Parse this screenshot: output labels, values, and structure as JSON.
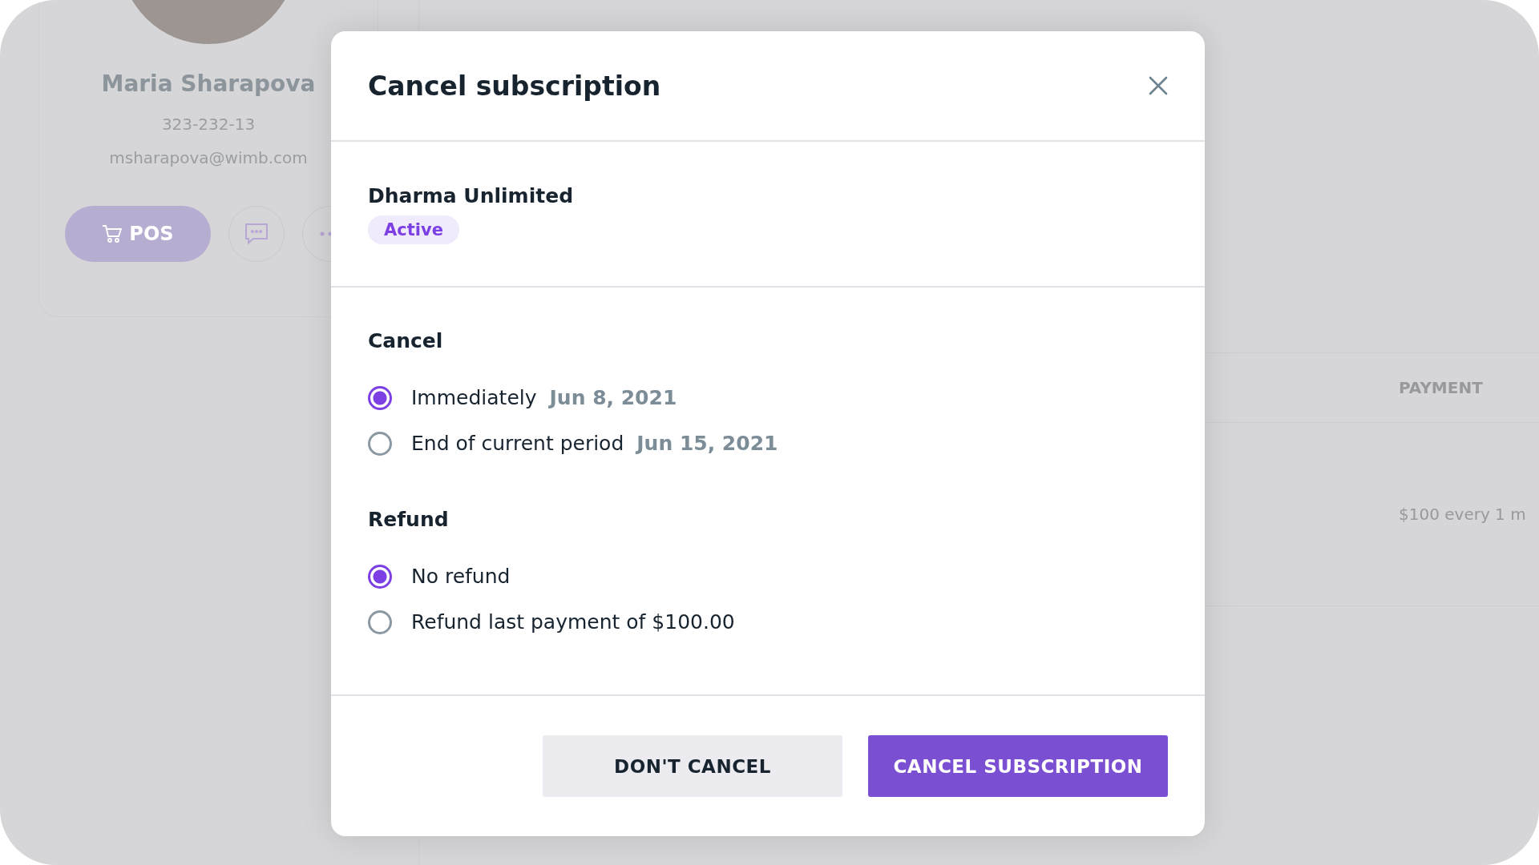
{
  "profile": {
    "name": "Maria Sharapova",
    "phone": "323-232-13",
    "email": "msharapova@wimb.com",
    "pos_button": "POS"
  },
  "table": {
    "columns": [
      "PAYMENT"
    ],
    "rows": [
      {
        "payment": "$100 every 1 m"
      }
    ]
  },
  "dialog": {
    "title": "Cancel subscription",
    "plan": {
      "name": "Dharma Unlimited",
      "status": "Active"
    },
    "cancel": {
      "heading": "Cancel",
      "options": [
        {
          "label": "Immediately",
          "date": "Jun 8, 2021",
          "selected": true
        },
        {
          "label": "End of current period",
          "date": "Jun 15, 2021",
          "selected": false
        }
      ]
    },
    "refund": {
      "heading": "Refund",
      "options": [
        {
          "label": "No refund",
          "selected": true
        },
        {
          "label": "Refund last payment of $100.00",
          "selected": false
        }
      ]
    },
    "buttons": [
      {
        "label": "DON'T CANCEL",
        "kind": "secondary"
      },
      {
        "label": "CANCEL SUBSCRIPTION",
        "kind": "primary"
      }
    ]
  }
}
